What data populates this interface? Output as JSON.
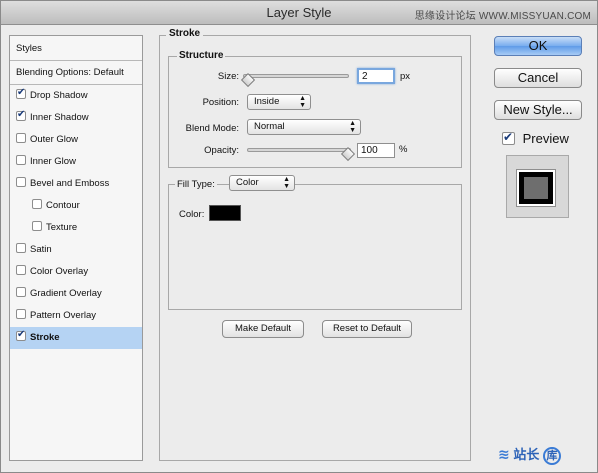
{
  "window": {
    "title": "Layer Style",
    "watermark": "思缘设计论坛 WWW.MISSYUAN.COM"
  },
  "styles_list": {
    "header": "Styles",
    "blending": "Blending Options: Default",
    "items": [
      {
        "label": "Drop Shadow",
        "checked": true,
        "indent": false,
        "selected": false
      },
      {
        "label": "Inner Shadow",
        "checked": true,
        "indent": false,
        "selected": false
      },
      {
        "label": "Outer Glow",
        "checked": false,
        "indent": false,
        "selected": false
      },
      {
        "label": "Inner Glow",
        "checked": false,
        "indent": false,
        "selected": false
      },
      {
        "label": "Bevel and Emboss",
        "checked": false,
        "indent": false,
        "selected": false
      },
      {
        "label": "Contour",
        "checked": false,
        "indent": true,
        "selected": false
      },
      {
        "label": "Texture",
        "checked": false,
        "indent": true,
        "selected": false
      },
      {
        "label": "Satin",
        "checked": false,
        "indent": false,
        "selected": false
      },
      {
        "label": "Color Overlay",
        "checked": false,
        "indent": false,
        "selected": false
      },
      {
        "label": "Gradient Overlay",
        "checked": false,
        "indent": false,
        "selected": false
      },
      {
        "label": "Pattern Overlay",
        "checked": false,
        "indent": false,
        "selected": false
      },
      {
        "label": "Stroke",
        "checked": true,
        "indent": false,
        "selected": true
      }
    ]
  },
  "stroke": {
    "title": "Stroke",
    "structure_title": "Structure",
    "size_label": "Size:",
    "size_value": "2",
    "size_unit": "px",
    "size_level": 0.0,
    "position_label": "Position:",
    "position_value": "Inside",
    "blend_label": "Blend Mode:",
    "blend_value": "Normal",
    "opacity_label": "Opacity:",
    "opacity_value": "100",
    "opacity_unit": "%",
    "opacity_level": 1.0,
    "fill_type_label": "Fill Type:",
    "fill_type_value": "Color",
    "color_label": "Color:",
    "color_value": "#000000",
    "make_default": "Make Default",
    "reset_default": "Reset to Default"
  },
  "actions": {
    "ok": "OK",
    "cancel": "Cancel",
    "new_style": "New Style...",
    "preview": "Preview",
    "preview_checked": true
  },
  "logo": {
    "text": "站长",
    "badge": "库"
  }
}
